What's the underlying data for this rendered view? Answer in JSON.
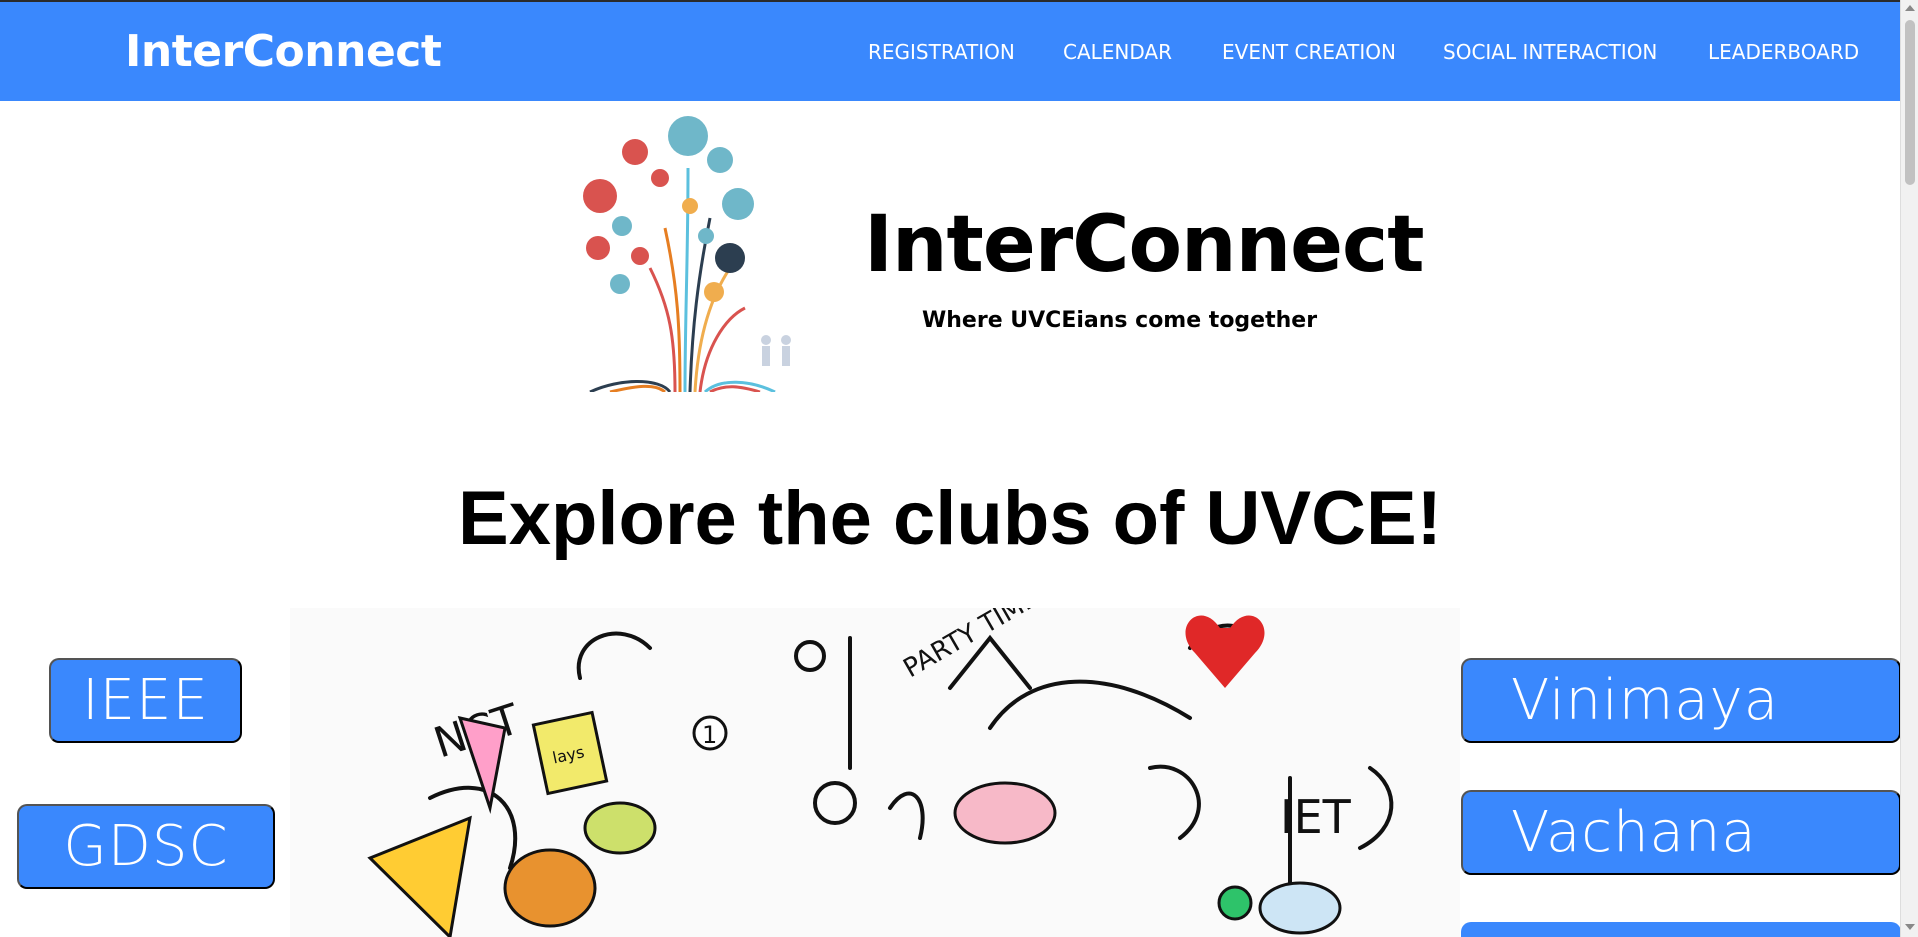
{
  "navbar": {
    "brand": "InterConnect",
    "links": [
      "REGISTRATION",
      "CALENDAR",
      "EVENT CREATION",
      "SOCIAL INTERACTION",
      "LEADERBOARD"
    ]
  },
  "hero": {
    "title": "InterConnect",
    "tagline": "Where UVCEians come together",
    "logo_icon": "knowledge-tree-logo"
  },
  "clubs": {
    "heading": "Explore the clubs of UVCE!",
    "left": [
      "IEEE",
      "GDSC"
    ],
    "right": [
      "Vinimaya",
      "Vachana"
    ],
    "doodle_labels": [
      "NCT",
      "IET",
      "PARTY TIME",
      "lays",
      "1"
    ]
  },
  "colors": {
    "accent": "#3a88fd",
    "white": "#ffffff",
    "text": "#000000"
  }
}
